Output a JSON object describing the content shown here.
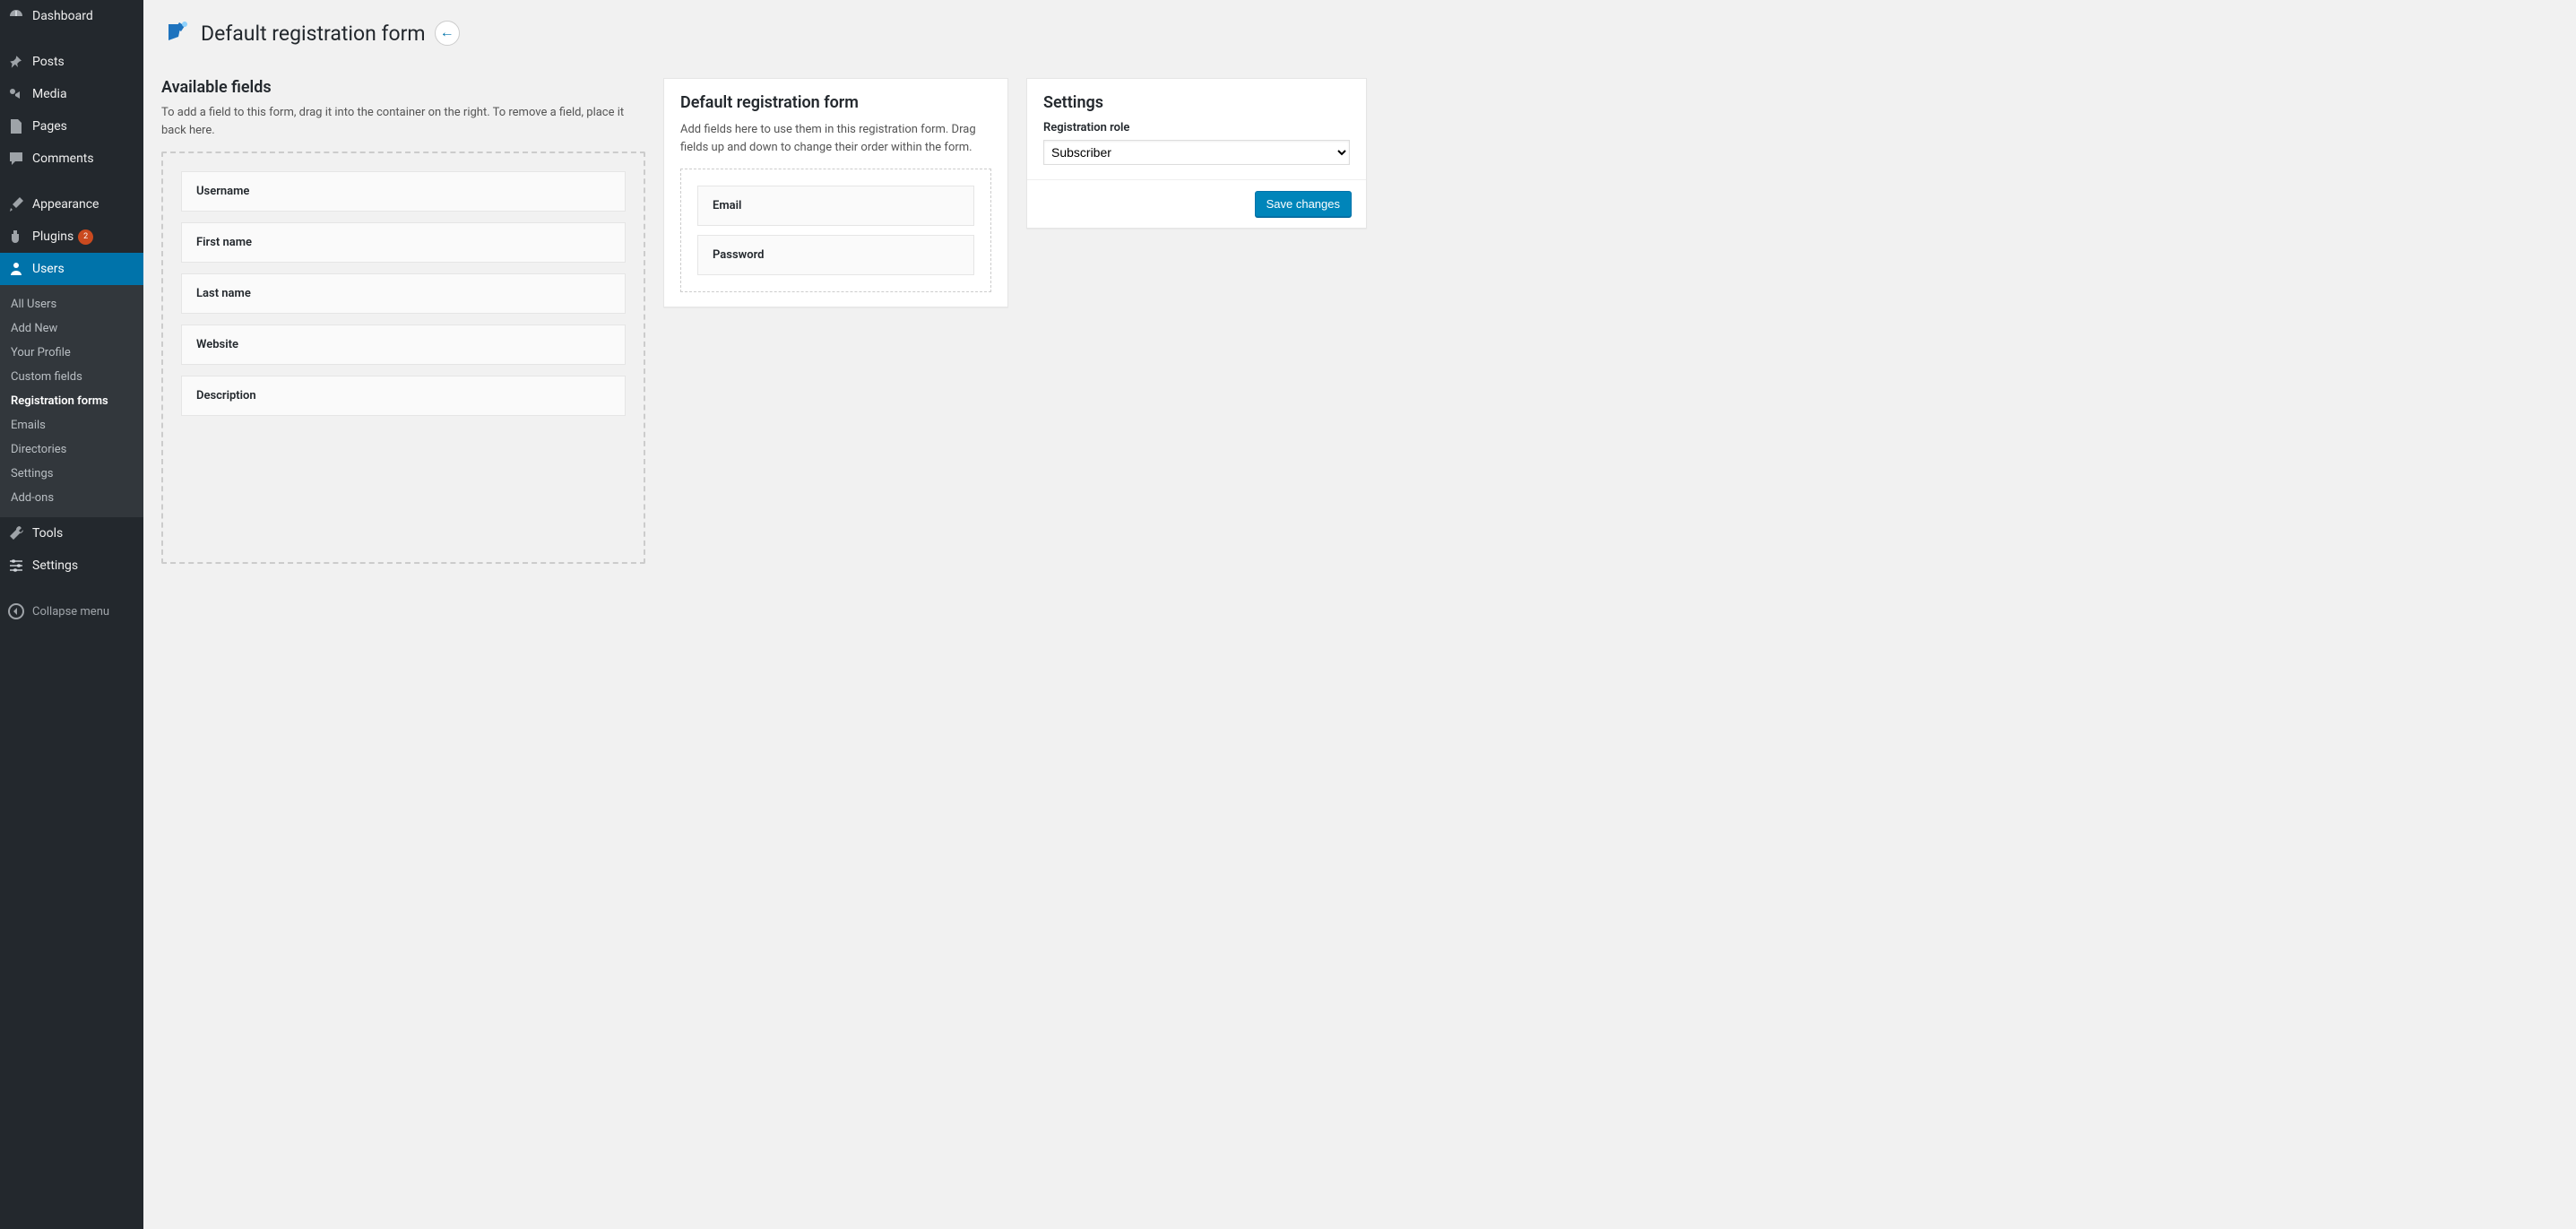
{
  "sidebar": {
    "items": [
      {
        "label": "Dashboard",
        "icon": "dashboard"
      },
      {
        "label": "Posts",
        "icon": "pin"
      },
      {
        "label": "Media",
        "icon": "media"
      },
      {
        "label": "Pages",
        "icon": "page"
      },
      {
        "label": "Comments",
        "icon": "comment"
      },
      {
        "label": "Appearance",
        "icon": "brush"
      },
      {
        "label": "Plugins",
        "icon": "plug",
        "badge": "2"
      },
      {
        "label": "Users",
        "icon": "user",
        "current": true
      },
      {
        "label": "Tools",
        "icon": "wrench"
      },
      {
        "label": "Settings",
        "icon": "sliders"
      }
    ],
    "submenu": [
      {
        "label": "All Users"
      },
      {
        "label": "Add New"
      },
      {
        "label": "Your Profile"
      },
      {
        "label": "Custom fields"
      },
      {
        "label": "Registration forms",
        "current": true
      },
      {
        "label": "Emails"
      },
      {
        "label": "Directories"
      },
      {
        "label": "Settings"
      },
      {
        "label": "Add-ons"
      }
    ],
    "collapse_label": "Collapse menu"
  },
  "header": {
    "title": "Default registration form"
  },
  "available": {
    "title": "Available fields",
    "desc": "To add a field to this form, drag it into the container on the right. To remove a field, place it back here.",
    "fields": [
      "Username",
      "First name",
      "Last name",
      "Website",
      "Description"
    ]
  },
  "form_panel": {
    "title": "Default registration form",
    "desc": "Add fields here to use them in this registration form. Drag fields up and down to change their order within the form.",
    "fields": [
      "Email",
      "Password"
    ]
  },
  "settings_panel": {
    "title": "Settings",
    "role_label": "Registration role",
    "role_value": "Subscriber",
    "save_label": "Save changes"
  }
}
